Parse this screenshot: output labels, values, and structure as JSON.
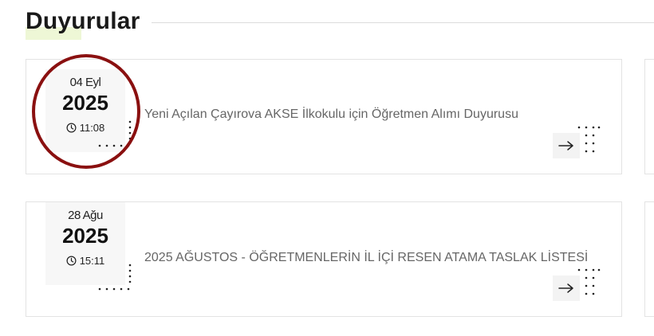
{
  "section": {
    "title": "Duyurular"
  },
  "announcements": [
    {
      "day_month": "04 Eyl",
      "year": "2025",
      "time": "11:08",
      "title": "Yeni Açılan Çayırova AKSE İlkokulu için Öğretmen Alımı Duyurusu"
    },
    {
      "day_month": "28 Ağu",
      "year": "2025",
      "time": "15:11",
      "title": "2025 AĞUSTOS - ÖĞRETMENLERİN İL İÇİ RESEN ATAMA TASLAK LİSTESİ"
    }
  ],
  "icons": {
    "clock": "clock-icon",
    "arrow": "arrow-right-icon"
  },
  "colors": {
    "highlight_ring": "#8a1010",
    "title_highlight": "#eef7d6",
    "title_text": "#1a1a1a",
    "card_text": "#666666"
  }
}
